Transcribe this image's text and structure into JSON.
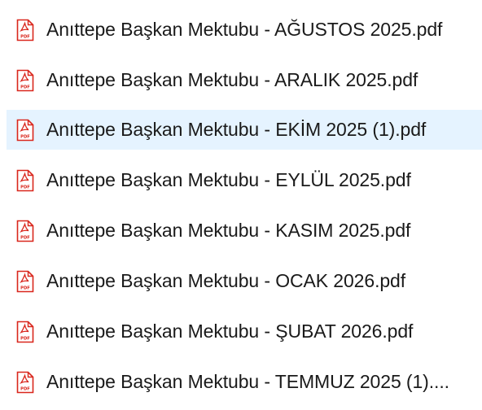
{
  "files": [
    {
      "name": "Anıttepe Başkan Mektubu - AĞUSTOS 2025.pdf",
      "icon": "pdf-file-icon",
      "selected": false
    },
    {
      "name": "Anıttepe Başkan Mektubu - ARALIK 2025.pdf",
      "icon": "pdf-file-icon",
      "selected": false
    },
    {
      "name": "Anıttepe Başkan Mektubu - EKİM 2025 (1).pdf",
      "icon": "pdf-file-icon",
      "selected": true
    },
    {
      "name": "Anıttepe Başkan Mektubu - EYLÜL 2025.pdf",
      "icon": "pdf-file-icon",
      "selected": false
    },
    {
      "name": "Anıttepe Başkan Mektubu - KASIM 2025.pdf",
      "icon": "pdf-file-icon",
      "selected": false
    },
    {
      "name": "Anıttepe Başkan Mektubu - OCAK 2026.pdf",
      "icon": "pdf-file-icon",
      "selected": false
    },
    {
      "name": "Anıttepe Başkan Mektubu - ŞUBAT 2026.pdf",
      "icon": "pdf-file-icon",
      "selected": false
    },
    {
      "name": "Anıttepe Başkan Mektubu - TEMMUZ 2025 (1)....",
      "icon": "pdf-file-icon",
      "selected": false
    }
  ],
  "icon_label": "PDF",
  "colors": {
    "selection": "#e5f3ff",
    "pdf_red": "#d9261c"
  }
}
